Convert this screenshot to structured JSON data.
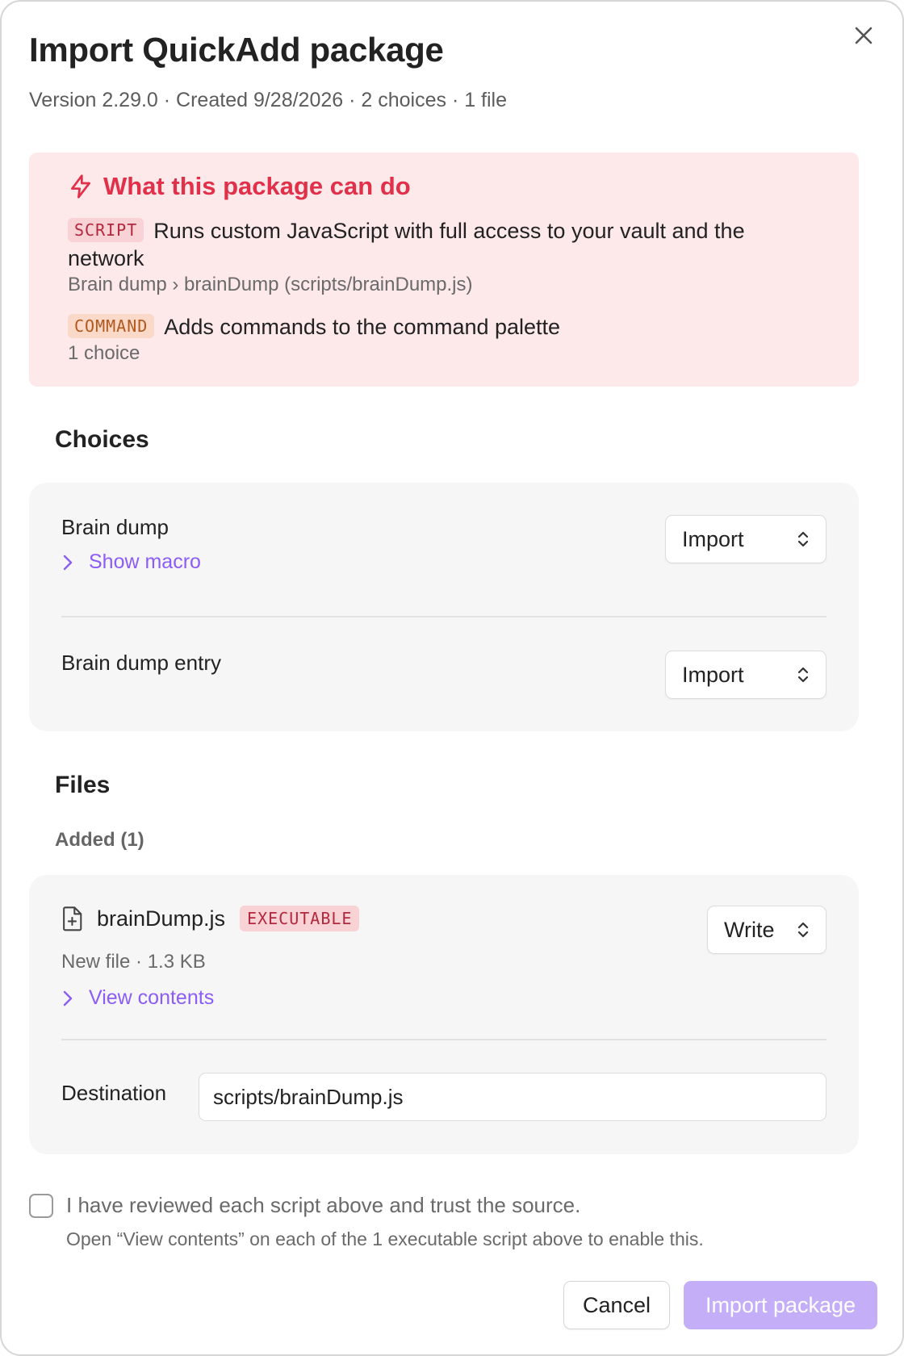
{
  "dialog": {
    "title": "Import QuickAdd package",
    "meta": "Version 2.29.0 · Created 9/28/2026 · 2 choices · 1 file",
    "close_icon": "close-icon"
  },
  "capabilities": {
    "title": "What this package can do",
    "icon": "lightning-icon",
    "accent_color": "#e0304a",
    "items": [
      {
        "badge": "SCRIPT",
        "description": "Runs custom JavaScript with full access to your vault and the network",
        "detail": "Brain dump › brainDump (scripts/brainDump.js)"
      },
      {
        "badge": "COMMAND",
        "description": "Adds commands to the command palette",
        "detail": "1 choice"
      }
    ]
  },
  "choices": {
    "heading": "Choices",
    "items": [
      {
        "name": "Brain dump",
        "toggle": "Show macro",
        "action": "Import"
      },
      {
        "name": "Brain dump entry",
        "action": "Import"
      }
    ]
  },
  "files": {
    "heading": "Files",
    "added_label": "Added (1)",
    "items": [
      {
        "name": "brainDump.js",
        "badge": "EXECUTABLE",
        "meta": "New file · 1.3 KB",
        "toggle": "View contents",
        "action": "Write",
        "destination_label": "Destination",
        "destination_value": "scripts/brainDump.js"
      }
    ]
  },
  "trust": {
    "label": "I have reviewed each script above and trust the source.",
    "help": "Open “View contents” on each of the 1 executable script above to enable this.",
    "checked": false
  },
  "footer": {
    "cancel_label": "Cancel",
    "import_label": "Import package",
    "primary_color": "#c4aef7"
  }
}
